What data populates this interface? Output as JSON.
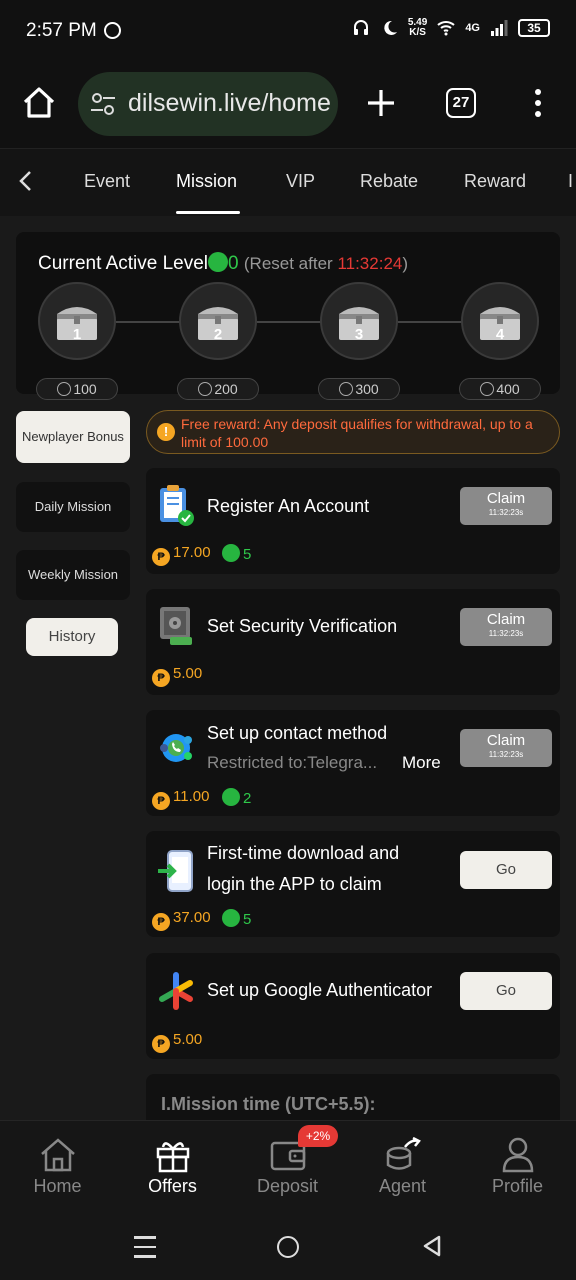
{
  "status_bar": {
    "time": "2:57 PM",
    "speed": "5.49",
    "speed_unit": "K/S",
    "network": "4G",
    "battery": "35"
  },
  "browser": {
    "url": "dilsewin.live/home",
    "tab_count": "27"
  },
  "category_tabs": [
    "Event",
    "Mission",
    "VIP",
    "Rebate",
    "Reward"
  ],
  "active_category": "Mission",
  "level_card": {
    "title": "Current Active Level",
    "level_value": "0",
    "reset_prefix": "(Reset after ",
    "reset_timer": "11:32:24",
    "reset_suffix": ")",
    "chests": [
      {
        "number": "1",
        "reward": "100"
      },
      {
        "number": "2",
        "reward": "200"
      },
      {
        "number": "3",
        "reward": "300"
      },
      {
        "number": "4",
        "reward": "400"
      }
    ]
  },
  "side_menu": {
    "items": [
      "Newplayer Bonus",
      "Daily Mission",
      "Weekly Mission"
    ],
    "active": "Newplayer Bonus",
    "history_label": "History"
  },
  "notice": "Free reward: Any deposit qualifies for withdrawal, up to a limit of 100.00",
  "missions": [
    {
      "title": "Register An Account",
      "icon": "clipboard-check-icon",
      "coins": "17.00",
      "bolts": "5",
      "action": "Claim",
      "timer": "11:32:23s"
    },
    {
      "title": "Set Security Verification",
      "icon": "safe-icon",
      "coins": "5.00",
      "bolts": "",
      "action": "Claim",
      "timer": "11:32:23s"
    },
    {
      "title": "Set up contact method",
      "subtitle": "Restricted to:Telegra...",
      "more": "More",
      "icon": "contact-apps-icon",
      "coins": "11.00",
      "bolts": "2",
      "action": "Claim",
      "timer": "11:32:23s"
    },
    {
      "title_line1": "First-time download and",
      "title_line2": "login the APP to claim",
      "icon": "phone-download-icon",
      "coins": "37.00",
      "bolts": "5",
      "action": "Go"
    },
    {
      "title": "Set up Google Authenticator",
      "icon": "google-authenticator-icon",
      "coins": "5.00",
      "bolts": "",
      "action": "Go"
    }
  ],
  "rules_title": "I.Mission time (UTC+5.5):",
  "bottom_nav": {
    "items": [
      "Home",
      "Offers",
      "Deposit",
      "Agent",
      "Profile"
    ],
    "active": "Offers",
    "deposit_badge": "+2%"
  },
  "colors": {
    "accent_green": "#27b540",
    "coin_orange": "#f5a623",
    "timer_red": "#e53935",
    "notice_red": "#ff6a3d"
  }
}
